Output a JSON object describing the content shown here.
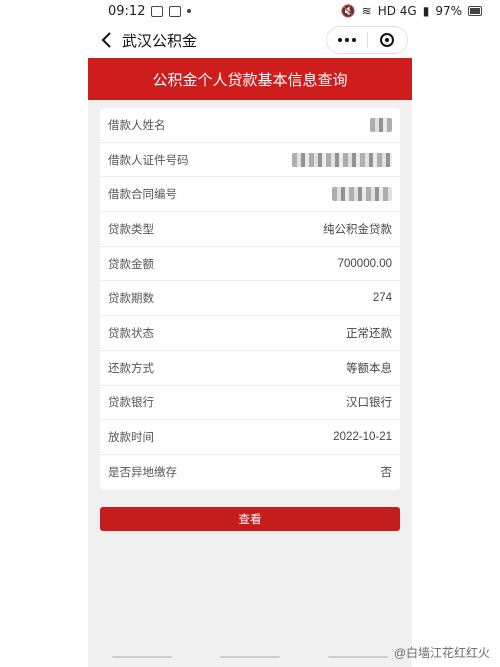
{
  "status_bar": {
    "time": "09:12",
    "battery": "97%",
    "network": "HD 4G"
  },
  "header": {
    "title": "武汉公积金"
  },
  "banner": {
    "title": "公积金个人贷款基本信息查询"
  },
  "info_rows": [
    {
      "label": "借款人姓名",
      "value": ""
    },
    {
      "label": "借款人证件号码",
      "value": ""
    },
    {
      "label": "借款合同编号",
      "value": ""
    },
    {
      "label": "贷款类型",
      "value": "纯公积金贷款"
    },
    {
      "label": "贷款金额",
      "value": "700000.00"
    },
    {
      "label": "贷款期数",
      "value": "274"
    },
    {
      "label": "贷款状态",
      "value": "正常还款"
    },
    {
      "label": "还款方式",
      "value": "等额本息"
    },
    {
      "label": "贷款银行",
      "value": "汉口银行"
    },
    {
      "label": "放款时间",
      "value": "2022-10-21"
    },
    {
      "label": "是否异地缴存",
      "value": "否"
    }
  ],
  "actions": {
    "query_label": "查看"
  },
  "watermark": "@白墙江花红红火"
}
